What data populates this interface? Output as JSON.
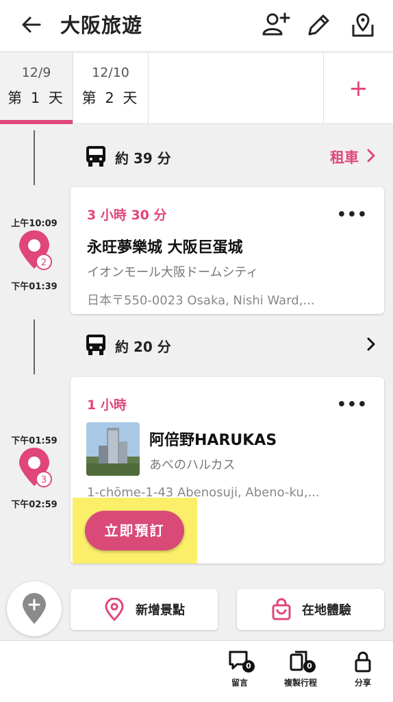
{
  "header": {
    "title": "大阪旅遊",
    "icons": [
      "back-arrow-icon",
      "add-user-icon",
      "edit-pencil-icon",
      "map-pin-icon"
    ]
  },
  "tabs": [
    {
      "date": "12/9",
      "label": "第 1 天",
      "active": true
    },
    {
      "date": "12/10",
      "label": "第 2 天",
      "active": false
    }
  ],
  "add_day": "+",
  "transits": [
    {
      "time": "約 39 分",
      "link": "租車"
    },
    {
      "time": "約 20 分",
      "link": ""
    }
  ],
  "stops": [
    {
      "start": "上午10:09",
      "end": "下午01:39",
      "index": "2",
      "duration": "3 小時 30 分",
      "name": "永旺夢樂城 大阪巨蛋城",
      "alt_name": "イオンモール大阪ドームシティ",
      "address": "日本〒550-0023 Osaka, Nishi Ward,..."
    },
    {
      "start": "下午01:59",
      "end": "下午02:59",
      "index": "3",
      "duration": "1 小時",
      "name": "阿倍野HARUKAS",
      "alt_name": "あべのハルカス",
      "address": "1-chōme-1-43 Abenosuji, Abeno-ku,...",
      "book_label": "立即預訂"
    }
  ],
  "more": "•••",
  "actions": {
    "add_spot": "新增景點",
    "local_experience": "在地體驗"
  },
  "footer": {
    "comments": {
      "label": "留言",
      "count": "0"
    },
    "copy_itinerary": {
      "label": "複製行程",
      "count": "0"
    },
    "share": {
      "label": "分享"
    }
  },
  "colors": {
    "accent": "#e0457b",
    "highlight": "#fbef6a"
  }
}
